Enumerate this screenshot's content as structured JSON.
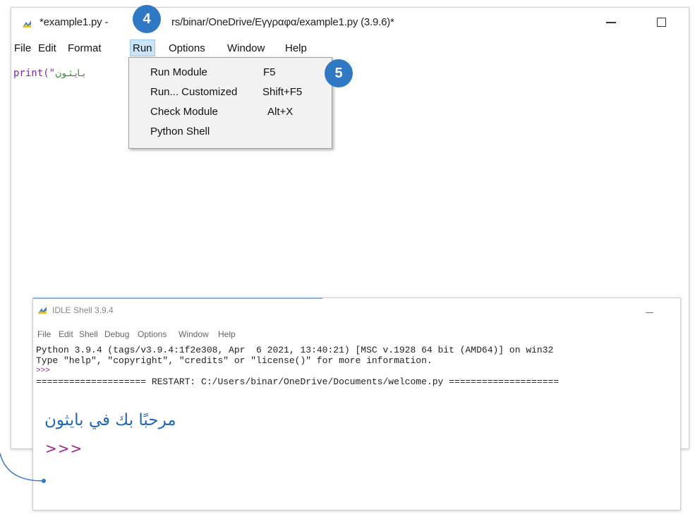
{
  "editor": {
    "title_file": "*example1.py -",
    "title_path": "rs/binar/OneDrive/Εγγραφα/example1.py (3.9.6)*",
    "menu": [
      "File",
      "Edit",
      "Format",
      "Run",
      "Options",
      "Window",
      "Help"
    ],
    "code": {
      "keyword": "print",
      "open": "(\"",
      "string": "بـايـثـون"
    }
  },
  "run_menu": {
    "items": [
      {
        "label": "Run Module",
        "shortcut": "F5"
      },
      {
        "label": "Run... Customized",
        "shortcut": "Shift+F5"
      },
      {
        "label": "Check Module",
        "shortcut": "Alt+X"
      },
      {
        "label": "Python Shell",
        "shortcut": ""
      }
    ]
  },
  "badges": {
    "step4": "4",
    "step5": "5"
  },
  "shell": {
    "title": "IDLE Shell 3.9.4",
    "menu": [
      "File",
      "Edit",
      "Shell",
      "Debug",
      "Options",
      "Window",
      "Help"
    ],
    "console": [
      "Python 3.9.4 (tags/v3.9.4:1f2e308, Apr  6 2021, 13:40:21) [MSC v.1928 64 bit (AMD64)] on win32",
      "Type \"help\", \"copyright\", \"credits\" or \"license()\" for more information.",
      ">>>",
      "==================== RESTART: C:/Users/binar/OneDrive/Documents/welcome.py ===================="
    ],
    "output": "مرحبًا بك في بايثون",
    "prompt": ">>>"
  },
  "colors": {
    "badge": "#2f78c4",
    "output_text": "#1f68b7",
    "prompt": "#9b1f8a",
    "run_highlight": "#cce4f7"
  }
}
